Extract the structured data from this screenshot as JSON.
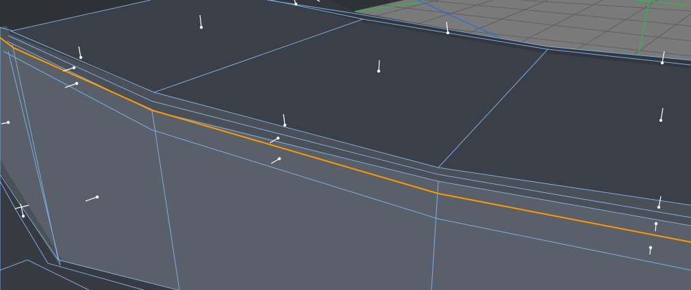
{
  "viewport": {
    "view": "perspective",
    "mode": "polygon-edit",
    "colors": {
      "background": "#2e3136",
      "top_face": "#3b3f47",
      "side_face": "#5a6069",
      "inner_ring_face": "#373a40",
      "rim_band": "#4f545c",
      "wire_edge": "#7aaee3",
      "selected_edge": "#ff9a00",
      "grid_floor": "#7a7a7a",
      "grid_line": "#5f5f5f",
      "axis_x": "#2db84a",
      "axis_z": "#2d6fd8",
      "normal_marker": "#ffffff"
    },
    "icons": {
      "normal_marker": "vertex-normal-icon",
      "grid": "ground-grid-icon"
    }
  }
}
